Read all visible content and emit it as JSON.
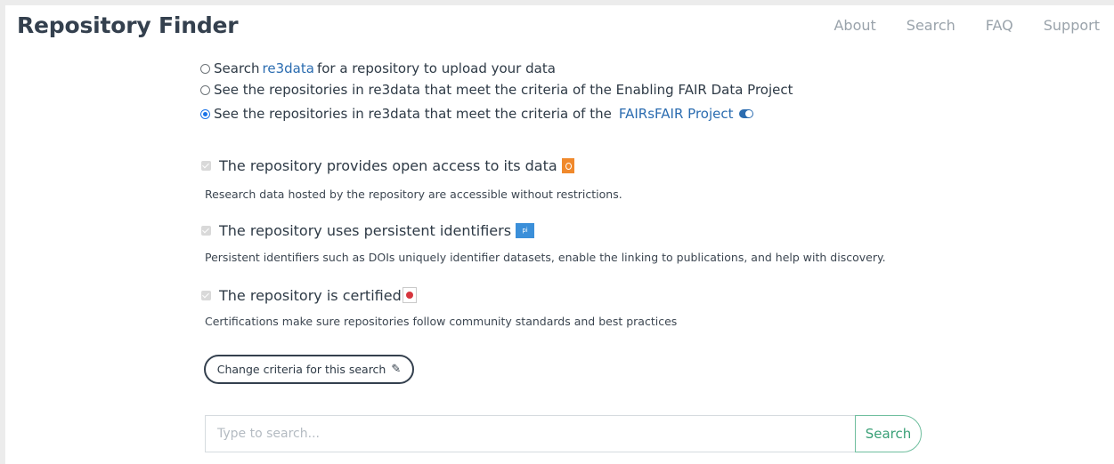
{
  "header": {
    "brand": "Repository Finder",
    "nav": [
      "About",
      "Search",
      "FAQ",
      "Support"
    ]
  },
  "options": [
    {
      "prefix": "Search",
      "link": "re3data",
      "suffix": "for a repository to upload your data",
      "checked": false
    },
    {
      "text": "See the repositories in re3data that meet the criteria of the Enabling FAIR Data Project",
      "checked": false
    },
    {
      "text": "See the repositories in re3data that meet the criteria of the",
      "link": "FAIRsFAIR Project",
      "checked": true
    }
  ],
  "criteria": [
    {
      "title": "The repository provides open access to its data",
      "description": "Research data hosted by the repository are accessible without restrictions.",
      "icon": "open-access-icon",
      "color": "#f0892c"
    },
    {
      "title": "The repository uses persistent identifiers",
      "description": "Persistent identifiers such as DOIs uniquely identifier datasets, enable the linking to publications, and help with discovery.",
      "icon": "persistent-identifier-icon",
      "badge_text": "pi",
      "color": "#3b8fd9"
    },
    {
      "title": "The repository is certified",
      "description": "Certifications make sure repositories follow community standards and best practices",
      "icon": "certified-icon",
      "color": "#d6353d"
    }
  ],
  "change_button": {
    "label": "Change criteria for this search",
    "icon": "pencil-icon"
  },
  "search": {
    "placeholder": "Type to search...",
    "button_label": "Search"
  },
  "colors": {
    "link": "#2b6cb0",
    "search_accent": "#3aa077",
    "text": "#34404e"
  }
}
